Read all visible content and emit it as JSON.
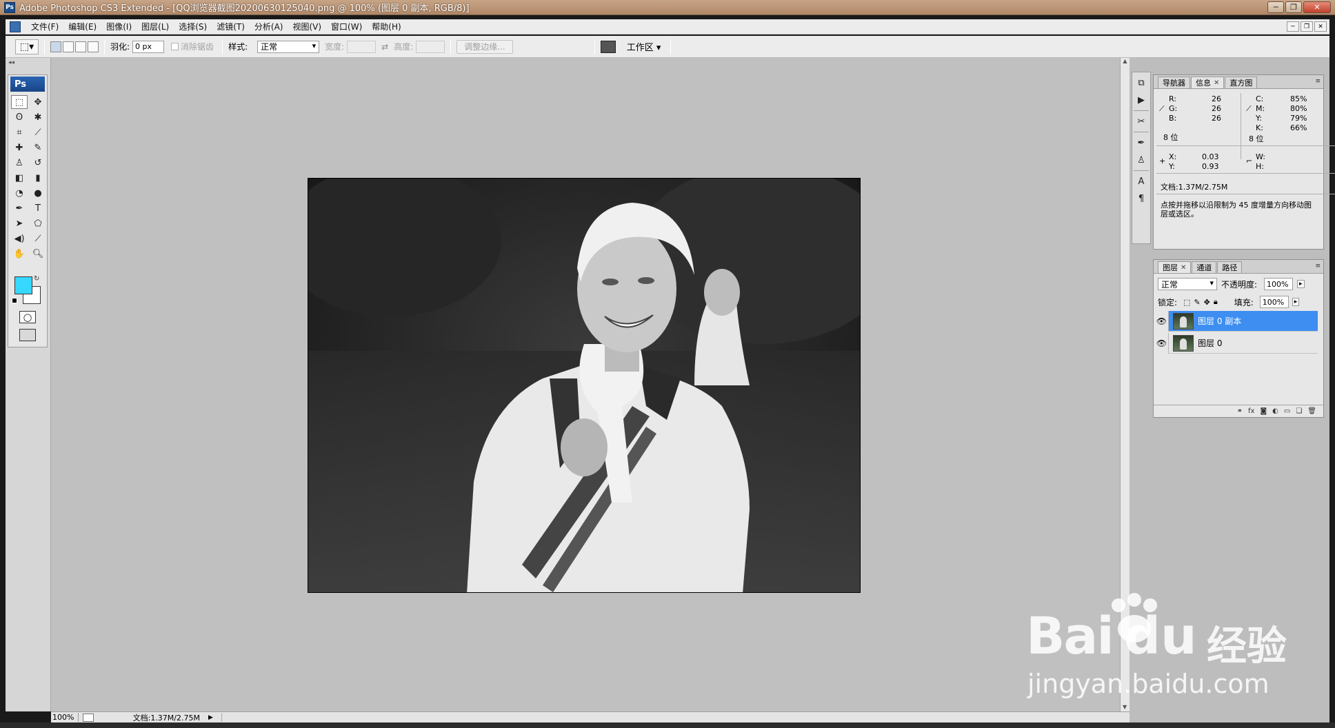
{
  "window": {
    "title": "Adobe Photoshop CS3 Extended - [QQ浏览器截图20200630125040.png @ 100% (图层 0 副本, RGB/8)]",
    "badge": "Ps",
    "minimize": "─",
    "restore": "❐",
    "close": "✕"
  },
  "menu": {
    "items": [
      "文件(F)",
      "编辑(E)",
      "图像(I)",
      "图层(L)",
      "选择(S)",
      "滤镜(T)",
      "分析(A)",
      "视图(V)",
      "窗口(W)",
      "帮助(H)"
    ]
  },
  "options": {
    "feather_label": "羽化:",
    "feather_value": "0 px",
    "antialias_label": "消除锯齿",
    "style_label": "样式:",
    "style_value": "正常",
    "width_label": "宽度:",
    "height_label": "高度:",
    "refine_edge": "调整边缘...",
    "workspace_label": "工作区 ▾"
  },
  "toolbox": {
    "title": "Ps"
  },
  "colors": {
    "foreground": "#36d8ff",
    "background": "#ffffff",
    "selected_layer": "#3d8ef0"
  },
  "status": {
    "zoom": "100%",
    "doc": "文档:1.37M/2.75M"
  },
  "info_panel": {
    "tabs": [
      "导航器",
      "信息",
      "直方图"
    ],
    "r_label": "R:",
    "r": "26",
    "g_label": "G:",
    "g": "26",
    "b_label": "B:",
    "b": "26",
    "c_label": "C:",
    "c": "85%",
    "m_label": "M:",
    "m": "80%",
    "y_label": "Y:",
    "yv": "79%",
    "k_label": "K:",
    "k": "66%",
    "bit_left": "8 位",
    "bit_right": "8 位",
    "x_label": "X:",
    "x": "0.03",
    "y2_label": "Y:",
    "y": "0.93",
    "w_label": "W:",
    "h_label": "H:",
    "doc": "文档:1.37M/2.75M",
    "hint": "点按并拖移以沿限制为 45 度增量方向移动图层或选区。"
  },
  "layers_panel": {
    "tabs": [
      "图层",
      "通道",
      "路径"
    ],
    "blend": "正常",
    "opacity_label": "不透明度:",
    "opacity": "100%",
    "lock_label": "锁定:",
    "fill_label": "填充:",
    "fill": "100%",
    "layers": [
      {
        "name": "图层 0 副本",
        "selected": true
      },
      {
        "name": "图层 0",
        "selected": false
      }
    ]
  },
  "watermark": {
    "brand": "Bai",
    "brand2": "du",
    "cn": "经验",
    "url": "jingyan.baidu.com"
  }
}
